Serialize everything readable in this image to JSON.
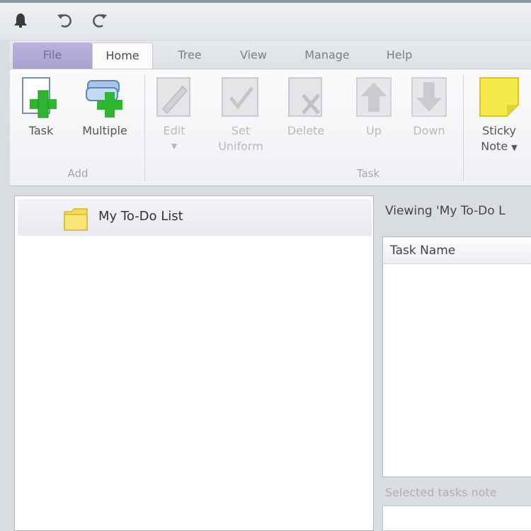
{
  "quick_access": {
    "items": [
      {
        "name": "app-menu",
        "icon": "bell-icon"
      },
      {
        "name": "undo",
        "icon": "undo-icon"
      },
      {
        "name": "redo",
        "icon": "redo-icon"
      }
    ]
  },
  "tabs": [
    {
      "label": "File",
      "state": "file"
    },
    {
      "label": "Home",
      "state": "active"
    },
    {
      "label": "Tree",
      "state": "normal"
    },
    {
      "label": "View",
      "state": "normal"
    },
    {
      "label": "Manage",
      "state": "normal"
    },
    {
      "label": "Help",
      "state": "normal"
    }
  ],
  "ribbon": {
    "add_group": {
      "label": "Add",
      "task_label": "Task",
      "multiple_label": "Multiple"
    },
    "task_group": {
      "label": "Task",
      "edit_label": "Edit",
      "set_uniform_line1": "Set",
      "set_uniform_line2": "Uniform",
      "delete_label": "Delete",
      "up_label": "Up",
      "down_label": "Down"
    },
    "sticky_note": {
      "line1": "Sticky",
      "line2": "Note"
    }
  },
  "tree": {
    "root_label": "My To-Do List"
  },
  "main": {
    "viewing_text": "Viewing 'My To-Do L",
    "column_task_name": "Task Name",
    "selected_notes_text": "Selected tasks note"
  },
  "colors": {
    "plus_green": "#2fb52f",
    "sticky_yellow": "#f6e94a",
    "file_tab": "#a9a4d2"
  }
}
